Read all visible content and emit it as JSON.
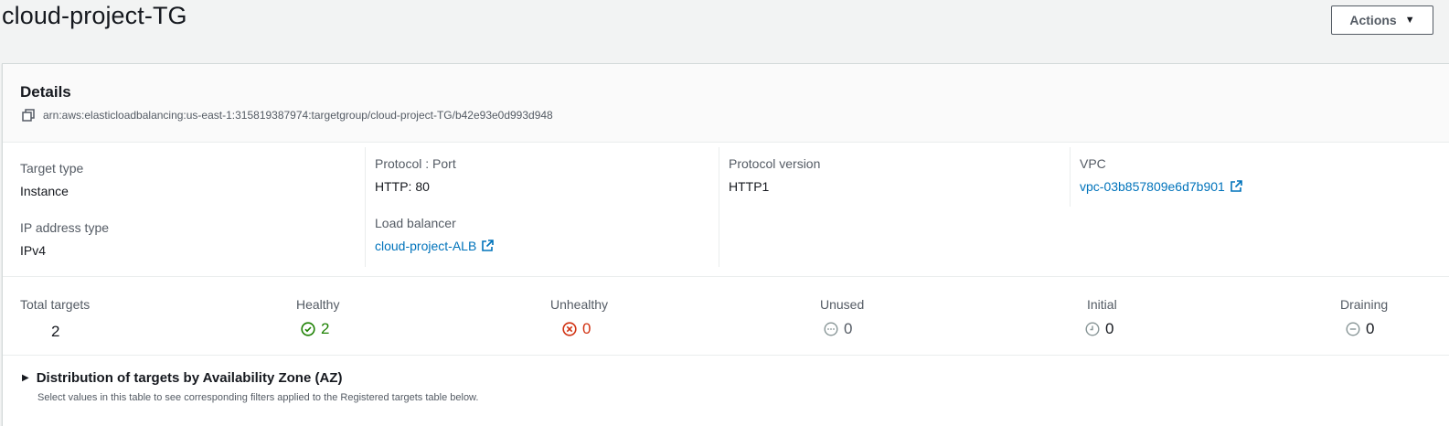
{
  "header": {
    "title": "cloud-project-TG",
    "actions_label": "Actions"
  },
  "details": {
    "title": "Details",
    "arn": "arn:aws:elasticloadbalancing:us-east-1:315819387974:targetgroup/cloud-project-TG/b42e93e0d993d948",
    "fields": {
      "target_type": {
        "label": "Target type",
        "value": "Instance"
      },
      "ip_address_type": {
        "label": "IP address type",
        "value": "IPv4"
      },
      "protocol_port": {
        "label": "Protocol : Port",
        "value": "HTTP: 80"
      },
      "load_balancer": {
        "label": "Load balancer",
        "value": "cloud-project-ALB"
      },
      "protocol_version": {
        "label": "Protocol version",
        "value": "HTTP1"
      },
      "vpc": {
        "label": "VPC",
        "value": "vpc-03b857809e6d7b901"
      }
    }
  },
  "targets": {
    "total": {
      "label": "Total targets",
      "value": "2"
    },
    "healthy": {
      "label": "Healthy",
      "value": "2",
      "icon": "check-circle-icon",
      "color": "#1d8102"
    },
    "unhealthy": {
      "label": "Unhealthy",
      "value": "0",
      "icon": "x-circle-icon",
      "color": "#d13212"
    },
    "unused": {
      "label": "Unused",
      "value": "0",
      "icon": "dots-circle-icon",
      "color": "#879596"
    },
    "initial": {
      "label": "Initial",
      "value": "0",
      "icon": "clock-icon",
      "color": "#879596"
    },
    "draining": {
      "label": "Draining",
      "value": "0",
      "icon": "minus-circle-icon",
      "color": "#879596"
    }
  },
  "az_section": {
    "title": "Distribution of targets by Availability Zone (AZ)",
    "description": "Select values in this table to see corresponding filters applied to the Registered targets table below."
  },
  "colors": {
    "link": "#0073bb",
    "text": "#16191f",
    "muted": "#545b64",
    "background": "#f2f3f3"
  }
}
